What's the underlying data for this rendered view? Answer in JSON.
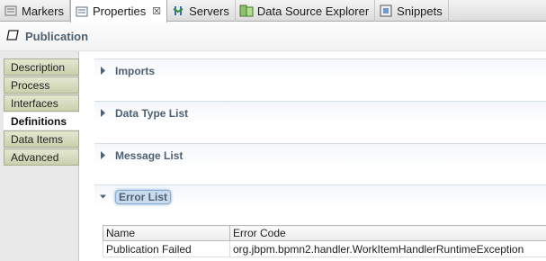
{
  "tabs": [
    {
      "label": "Markers",
      "icon": "markers-icon"
    },
    {
      "label": "Properties",
      "icon": "properties-icon",
      "active": true,
      "close": "☒"
    },
    {
      "label": "Servers",
      "icon": "servers-icon"
    },
    {
      "label": "Data Source Explorer",
      "icon": "data-source-explorer-icon"
    },
    {
      "label": "Snippets",
      "icon": "snippets-icon"
    }
  ],
  "header": {
    "title": "Publication",
    "icon": "publication-icon"
  },
  "sidebar": {
    "items": [
      {
        "label": "Description"
      },
      {
        "label": "Process"
      },
      {
        "label": "Interfaces"
      },
      {
        "label": "Definitions",
        "active": true
      },
      {
        "label": "Data Items"
      },
      {
        "label": "Advanced"
      }
    ]
  },
  "sections": [
    {
      "title": "Imports",
      "expanded": false
    },
    {
      "title": "Data Type List",
      "expanded": false
    },
    {
      "title": "Message List",
      "expanded": false
    },
    {
      "title": "Error List",
      "expanded": true
    }
  ],
  "error_table": {
    "columns": [
      "Name",
      "Error Code"
    ],
    "rows": [
      [
        "Publication Failed",
        "org.jbpm.bpmn2.handler.WorkItemHandlerRuntimeException"
      ]
    ]
  },
  "colors": {
    "section_title": "#4d6072",
    "tab_active": "#ffffff",
    "sidebar_tab": "#cbd0ac"
  }
}
